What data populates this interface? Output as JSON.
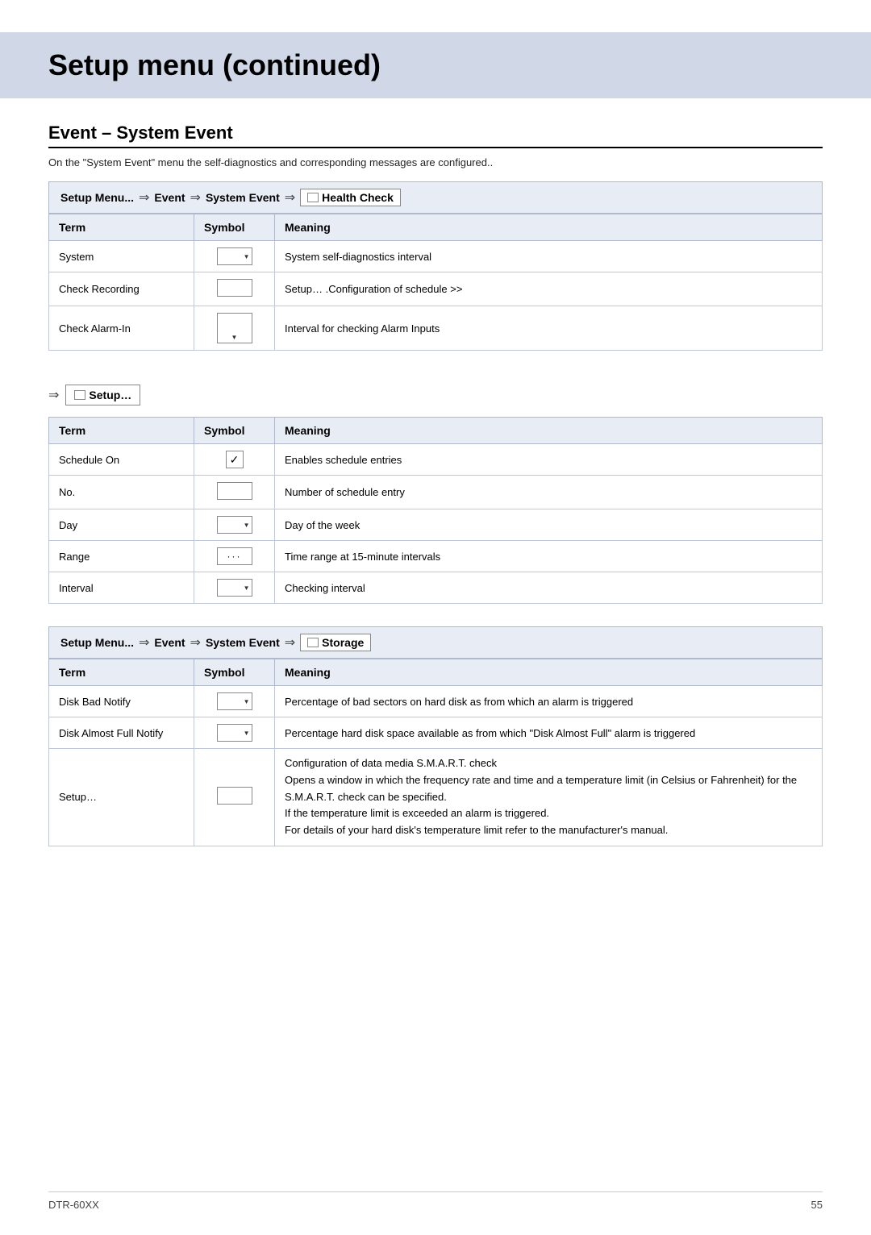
{
  "page": {
    "title": "Setup menu (continued)",
    "footer_left": "DTR-60XX",
    "footer_right": "55"
  },
  "section1": {
    "title": "Event – System Event",
    "description": "On the \"System Event\" menu the self-diagnostics and corresponding messages are configured..",
    "breadcrumb": {
      "items": [
        "Setup Menu...",
        "Event",
        "System Event",
        "Health Check"
      ]
    },
    "table": {
      "headers": [
        "Term",
        "Symbol",
        "Meaning"
      ],
      "rows": [
        {
          "term": "System",
          "symbol": "dropdown",
          "meaning": "System self-diagnostics interval"
        },
        {
          "term": "Check Recording",
          "symbol": "box",
          "meaning": "Setup…  .Configuration of schedule >>"
        },
        {
          "term": "Check Alarm-In",
          "symbol": "dropdown-tall",
          "meaning": "Interval for checking Alarm Inputs"
        }
      ]
    }
  },
  "setup_arrow": {
    "label": "Setup…"
  },
  "section2": {
    "table": {
      "headers": [
        "Term",
        "Symbol",
        "Meaning"
      ],
      "rows": [
        {
          "term": "Schedule On",
          "symbol": "check",
          "meaning": "Enables schedule entries"
        },
        {
          "term": "No.",
          "symbol": "box",
          "meaning": "Number of schedule entry"
        },
        {
          "term": "Day",
          "symbol": "dropdown",
          "meaning": "Day of the week"
        },
        {
          "term": "Range",
          "symbol": "ellipsis",
          "meaning": "Time range at 15-minute intervals"
        },
        {
          "term": "Interval",
          "symbol": "dropdown",
          "meaning": "Checking interval"
        }
      ]
    }
  },
  "section3": {
    "breadcrumb": {
      "items": [
        "Setup Menu...",
        "Event",
        "System Event",
        "Storage"
      ]
    },
    "table": {
      "headers": [
        "Term",
        "Symbol",
        "Meaning"
      ],
      "rows": [
        {
          "term": "Disk Bad Notify",
          "symbol": "dropdown",
          "meaning": "Percentage of bad sectors on hard disk as from which an alarm is triggered"
        },
        {
          "term": "Disk Almost Full Notify",
          "symbol": "dropdown",
          "meaning": "Percentage hard disk space available as from which \"Disk Almost Full\" alarm is triggered"
        },
        {
          "term": "Setup…",
          "symbol": "box",
          "meaning": "Configuration of data media S.M.A.R.T. check\nOpens a window in which the frequency rate and time and a temperature limit (in Celsius or Fahrenheit) for the S.M.A.R.T. check can be specified.\nIf the temperature limit is exceeded an alarm is triggered.\nFor details of your hard disk's temperature limit refer to the manufacturer's manual."
        }
      ]
    }
  }
}
